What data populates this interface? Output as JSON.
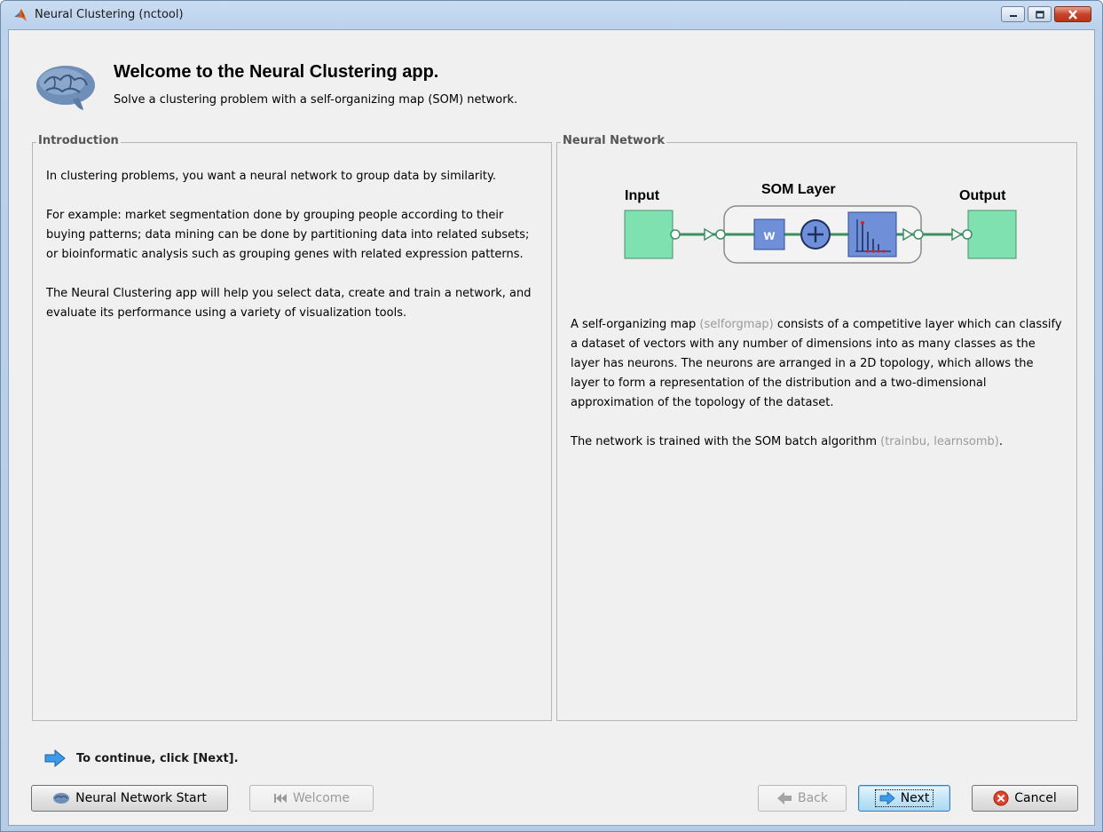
{
  "window": {
    "title": "Neural Clustering (nctool)",
    "controls": [
      "minimize-icon",
      "maximize-icon",
      "close-icon"
    ]
  },
  "header": {
    "title": "Welcome to the Neural Clustering app.",
    "subtitle": "Solve a clustering problem with a self-organizing map (SOM) network.",
    "icon": "brain-icon"
  },
  "introduction": {
    "legend": "Introduction",
    "paragraphs": [
      "In clustering problems, you want a neural network to group data by similarity.",
      "For example: market segmentation done by grouping people according to their buying patterns; data mining can be done by partitioning data into related subsets; or bioinformatic analysis such as grouping genes with related expression patterns.",
      "The Neural Clustering app will help you select data, create and train a network, and evaluate its performance using a variety of visualization tools."
    ]
  },
  "network": {
    "legend": "Neural Network",
    "diagram": {
      "input_label": "Input",
      "layer_label": "SOM Layer",
      "output_label": "Output",
      "weight_label": "w"
    },
    "desc1_before": "A self-organizing map ",
    "desc1_link": "(selforgmap)",
    "desc1_after": " consists of a competitive layer which can classify a dataset of vectors with any number of dimensions into as many classes as the layer has neurons. The neurons are arranged in a 2D topology, which allows the layer to form a representation of the distribution and a two-dimensional approximation of the topology of the dataset.",
    "desc2_before": "The network is trained with the SOM batch algorithm ",
    "desc2_link": "(trainbu, learnsomb)",
    "desc2_after": "."
  },
  "footer": {
    "hint": "To continue, click [Next].",
    "buttons": {
      "start": "Neural Network Start",
      "welcome": "Welcome",
      "back": "Back",
      "next": "Next",
      "cancel": "Cancel"
    }
  },
  "colors": {
    "accent_green": "#7fe0b0",
    "accent_blue": "#6f8fd8",
    "link_gray": "#9a9a9a"
  }
}
